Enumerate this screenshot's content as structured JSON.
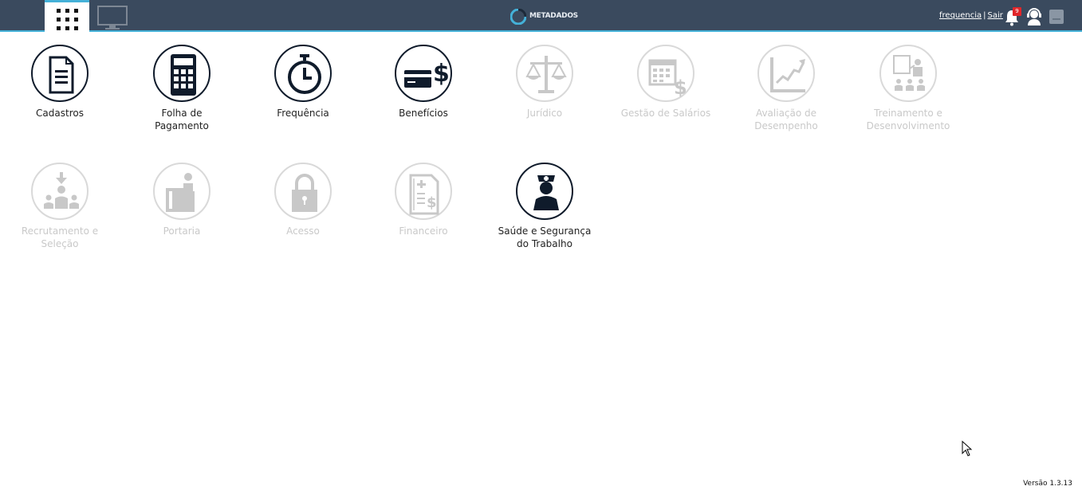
{
  "header": {
    "logo_text": "METADADOS",
    "user_link": "frequencia",
    "separator": "|",
    "logout_link": "Sair",
    "notification_count": "9"
  },
  "modules": [
    {
      "label": "Cadastros",
      "icon": "document-icon",
      "enabled": true
    },
    {
      "label": "Folha de Pagamento",
      "icon": "calculator-icon",
      "enabled": true
    },
    {
      "label": "Frequência",
      "icon": "stopwatch-icon",
      "enabled": true
    },
    {
      "label": "Benefícios",
      "icon": "card-dollar-icon",
      "enabled": true
    },
    {
      "label": "Jurídico",
      "icon": "scales-icon",
      "enabled": false
    },
    {
      "label": "Gestão de Salários",
      "icon": "calendar-dollar-icon",
      "enabled": false
    },
    {
      "label": "Avaliação de Desempenho",
      "icon": "growth-chart-icon",
      "enabled": false
    },
    {
      "label": "Treinamento e Desenvolvimento",
      "icon": "presentation-icon",
      "enabled": false
    },
    {
      "label": "Recrutamento e Seleção",
      "icon": "recruitment-icon",
      "enabled": false
    },
    {
      "label": "Portaria",
      "icon": "reception-desk-icon",
      "enabled": false
    },
    {
      "label": "Acesso",
      "icon": "padlock-icon",
      "enabled": false
    },
    {
      "label": "Financeiro",
      "icon": "invoice-dollar-icon",
      "enabled": false
    },
    {
      "label": "Saúde e Segurança do Trabalho",
      "icon": "nurse-icon",
      "enabled": true
    }
  ],
  "footer": {
    "version": "Versão 1.3.13"
  },
  "colors": {
    "topbar": "#3a4a5e",
    "accent": "#44b1d8",
    "icon_dark": "#0f1b2b",
    "disabled": "#d9d9d9"
  }
}
